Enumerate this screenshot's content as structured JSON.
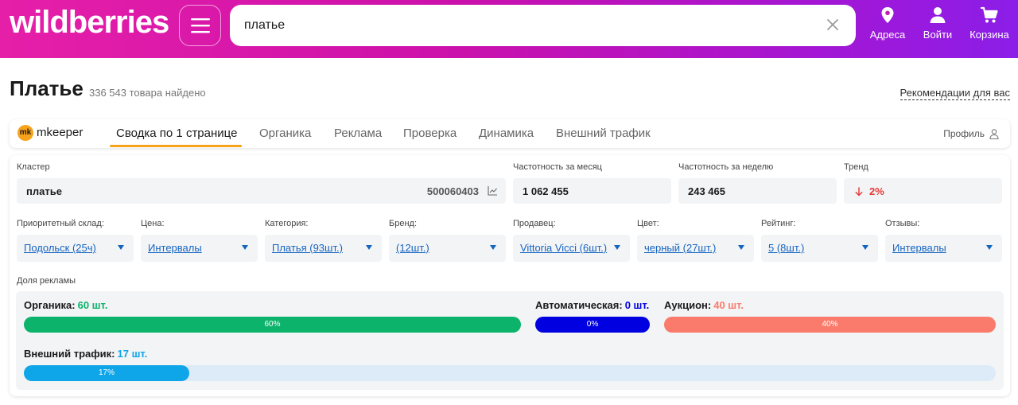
{
  "header": {
    "logo": "wildberries",
    "search": {
      "value": "платье",
      "placeholder": ""
    },
    "buttons": {
      "address": "Адреса",
      "login": "Войти",
      "cart": "Корзина"
    }
  },
  "page": {
    "title": "Платье",
    "found": "336 543 товара найдено",
    "recommendations": "Рекомендации для вас"
  },
  "tabs": {
    "brand": {
      "logo": "mk",
      "name": "mkeeper"
    },
    "items": [
      {
        "label": "Сводка по 1 странице"
      },
      {
        "label": "Органика"
      },
      {
        "label": "Реклама"
      },
      {
        "label": "Проверка"
      },
      {
        "label": "Динамика"
      },
      {
        "label": "Внешний трафик"
      }
    ],
    "profile": "Профиль"
  },
  "summary": {
    "cluster": {
      "label": "Кластер",
      "value": "платье",
      "id": "500060403"
    },
    "monthly": {
      "label": "Частотность за месяц",
      "value": "1 062 455"
    },
    "weekly": {
      "label": "Частотность за неделю",
      "value": "243 465"
    },
    "trend": {
      "label": "Тренд",
      "value": "2%"
    }
  },
  "filters": [
    {
      "label": "Приоритетный склад:",
      "value": "Подольск (25ч)"
    },
    {
      "label": "Цена:",
      "value": "Интервалы"
    },
    {
      "label": "Категория:",
      "value": "Платья (93шт.)"
    },
    {
      "label": "Бренд:",
      "value": "(12шт.)"
    },
    {
      "label": "Продавец:",
      "value": "Vittoria Vicci (6шт.)"
    },
    {
      "label": "Цвет:",
      "value": "черный (27шт.)"
    },
    {
      "label": "Рейтинг:",
      "value": "5 (8шт.)"
    },
    {
      "label": "Отзывы:",
      "value": "Интервалы"
    }
  ],
  "ads": {
    "label": "Доля рекламы",
    "organic": {
      "label": "Органика:",
      "count": "60 шт.",
      "pct": "60%",
      "share": 60,
      "color": "#0bb36b"
    },
    "auto": {
      "label": "Автоматическая:",
      "count": "0 шт.",
      "pct": "0%",
      "share": 0,
      "color": "#0000e0"
    },
    "auction": {
      "label": "Аукцион:",
      "count": "40 шт.",
      "pct": "40%",
      "share": 40,
      "color": "#fa7b6b"
    },
    "external": {
      "label": "Внешний трафик:",
      "count": "17 шт.",
      "pct": "17%",
      "share": 17,
      "color": "#0ea5e9"
    }
  }
}
